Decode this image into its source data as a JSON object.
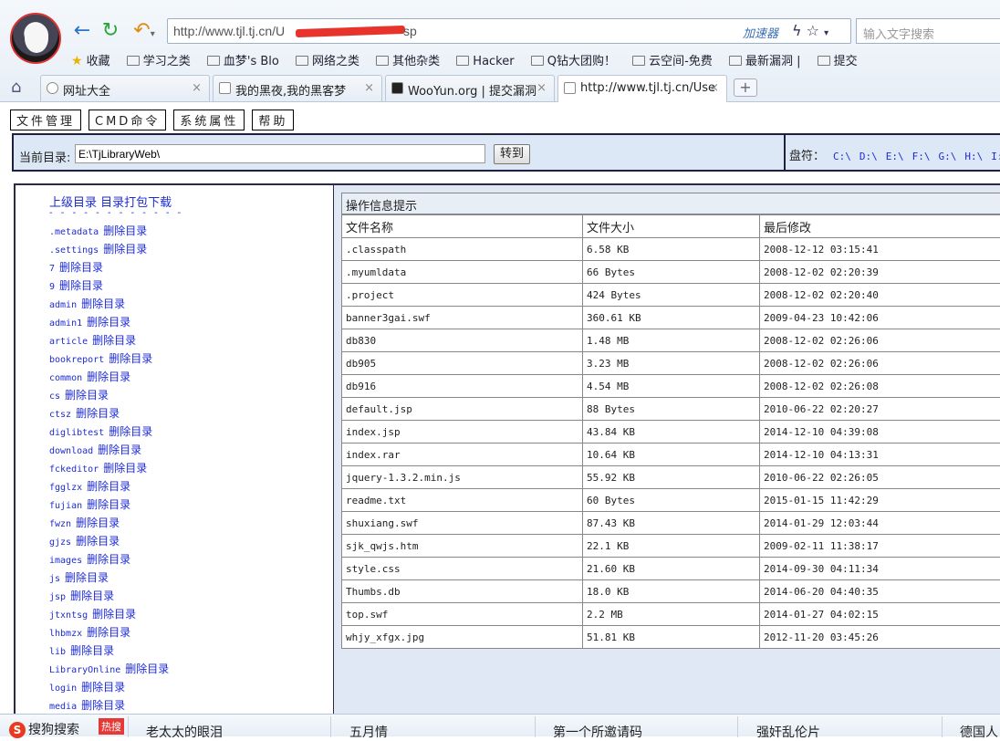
{
  "browser": {
    "url": "http://www.tjl.tj.cn/U",
    "url_tail": "sp",
    "accelerator": "加速器",
    "search_placeholder": "输入文字搜索",
    "bookmarks": [
      "收藏",
      "学习之类",
      "血梦's Blo",
      "网络之类",
      "其他杂类",
      "Hacker",
      "Q钻大团购！",
      "云空间-免费",
      "最新漏洞 |",
      "提交"
    ],
    "tabs": [
      "网址大全",
      "我的黑夜,我的黑客梦",
      "WooYun.org | 提交漏洞",
      "http://www.tjl.tj.cn/Use"
    ]
  },
  "menu": [
    "文件管理",
    "CMD命令",
    "系统属性",
    "帮助"
  ],
  "dirbar": {
    "label": "当前目录:",
    "path": "E:\\TjLibraryWeb\\",
    "go": "转到",
    "drives_label": "盘符：",
    "drives": [
      "C:\\",
      "D:\\",
      "E:\\",
      "F:\\",
      "G:\\",
      "H:\\",
      "I:"
    ]
  },
  "left": {
    "up": "上级目录",
    "pack": "目录打包下载",
    "dash": "- - - - - - - - - - - -",
    "delete_label": "删除目录",
    "dirs": [
      ".metadata",
      ".settings",
      "7",
      "9",
      "admin",
      "admin1",
      "article",
      "bookreport",
      "common",
      "cs",
      "ctsz",
      "diglibtest",
      "download",
      "fckeditor",
      "fgglzx",
      "fujian",
      "fwzn",
      "gjzs",
      "images",
      "js",
      "jsp",
      "jtxntsg",
      "lhbmzx",
      "lib",
      "LibraryOnline",
      "login",
      "media"
    ]
  },
  "files": {
    "info_title": "操作信息提示",
    "headers": [
      "文件名称",
      "文件大小",
      "最后修改"
    ],
    "rows": [
      [
        ".classpath",
        "6.58 KB",
        "2008-12-12 03:15:41"
      ],
      [
        ".myumldata",
        "66 Bytes",
        "2008-12-02 02:20:39"
      ],
      [
        ".project",
        "424 Bytes",
        "2008-12-02 02:20:40"
      ],
      [
        "banner3gai.swf",
        "360.61 KB",
        "2009-04-23 10:42:06"
      ],
      [
        "db830",
        "1.48 MB",
        "2008-12-02 02:26:06"
      ],
      [
        "db905",
        "3.23 MB",
        "2008-12-02 02:26:06"
      ],
      [
        "db916",
        "4.54 MB",
        "2008-12-02 02:26:08"
      ],
      [
        "default.jsp",
        "88 Bytes",
        "2010-06-22 02:20:27"
      ],
      [
        "index.jsp",
        "43.84 KB",
        "2014-12-10 04:39:08"
      ],
      [
        "index.rar",
        "10.64 KB",
        "2014-12-10 04:13:31"
      ],
      [
        "jquery-1.3.2.min.js",
        "55.92 KB",
        "2010-06-22 02:26:05"
      ],
      [
        "readme.txt",
        "60 Bytes",
        "2015-01-15 11:42:29"
      ],
      [
        "shuxiang.swf",
        "87.43 KB",
        "2014-01-29 12:03:44"
      ],
      [
        "sjk_qwjs.htm",
        "22.1 KB",
        "2009-02-11 11:38:17"
      ],
      [
        "style.css",
        "21.60 KB",
        "2014-09-30 04:11:34"
      ],
      [
        "Thumbs.db",
        "18.0 KB",
        "2014-06-20 04:40:35"
      ],
      [
        "top.swf",
        "2.2 MB",
        "2014-01-27 04:02:15"
      ],
      [
        "whjy_xfgx.jpg",
        "51.81 KB",
        "2012-11-20 03:45:26"
      ]
    ]
  },
  "status": {
    "logo": "搜狗搜索",
    "hot": "热搜",
    "items": [
      "老太太的眼泪",
      "五月情",
      "第一个所邀请码",
      "强奸乱伦片",
      "德国人"
    ]
  }
}
